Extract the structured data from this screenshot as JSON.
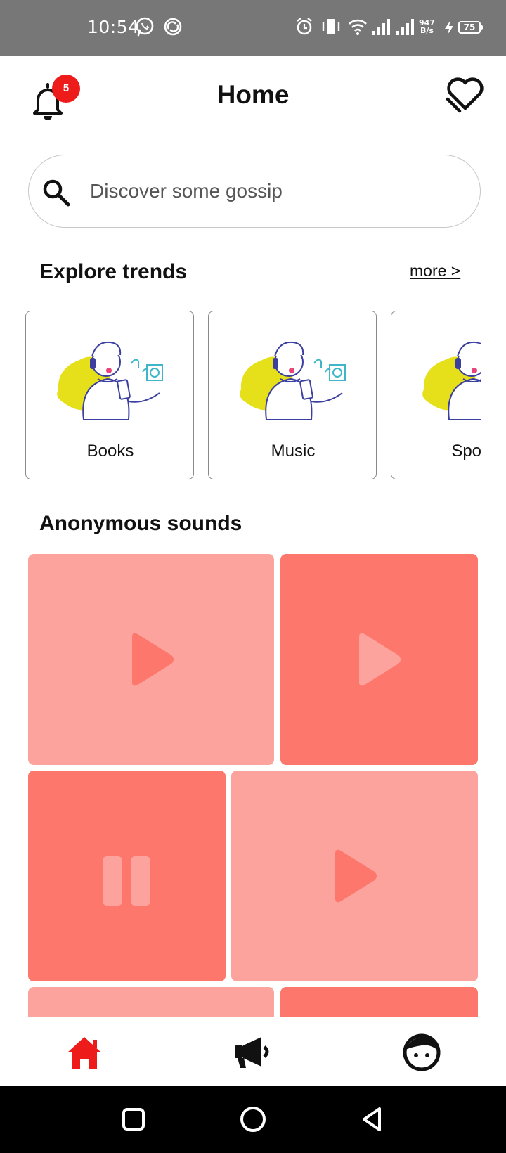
{
  "status_bar": {
    "time": "10:54",
    "net_speed_value": "947",
    "net_speed_unit": "B/s",
    "battery": "75",
    "icons": [
      "whatsapp-icon",
      "sync-icon",
      "alarm-icon",
      "vibrate-icon",
      "wifi-icon",
      "signal-icon",
      "signal-icon",
      "charging-icon"
    ]
  },
  "header": {
    "title": "Home",
    "notification_count": "5",
    "left_icon": "bell-icon",
    "right_icon": "heart-icon"
  },
  "search": {
    "placeholder": "Discover some gossip",
    "icon": "search-icon"
  },
  "explore": {
    "title": "Explore trends",
    "more_label": "more >",
    "cards": [
      {
        "label": "Books"
      },
      {
        "label": "Music"
      },
      {
        "label": "Sports"
      }
    ]
  },
  "sounds": {
    "title": "Anonymous sounds",
    "tiles": [
      {
        "shade": "light",
        "state": "play"
      },
      {
        "shade": "dark",
        "state": "play"
      },
      {
        "shade": "dark",
        "state": "pause"
      },
      {
        "shade": "light",
        "state": "play"
      },
      {
        "shade": "light",
        "state": "play"
      },
      {
        "shade": "dark",
        "state": "play"
      }
    ]
  },
  "bottom_nav": {
    "items": [
      {
        "name": "home",
        "icon": "home-icon",
        "active": true
      },
      {
        "name": "announcements",
        "icon": "megaphone-icon",
        "active": false
      },
      {
        "name": "profile",
        "icon": "face-icon",
        "active": false
      }
    ]
  },
  "colors": {
    "accent": "#ee1b1b",
    "tile_light": "#fba39c",
    "tile_dark": "#fd776c",
    "illustration_yellow": "#e6e01b",
    "illustration_blue": "#3a3fa0"
  }
}
